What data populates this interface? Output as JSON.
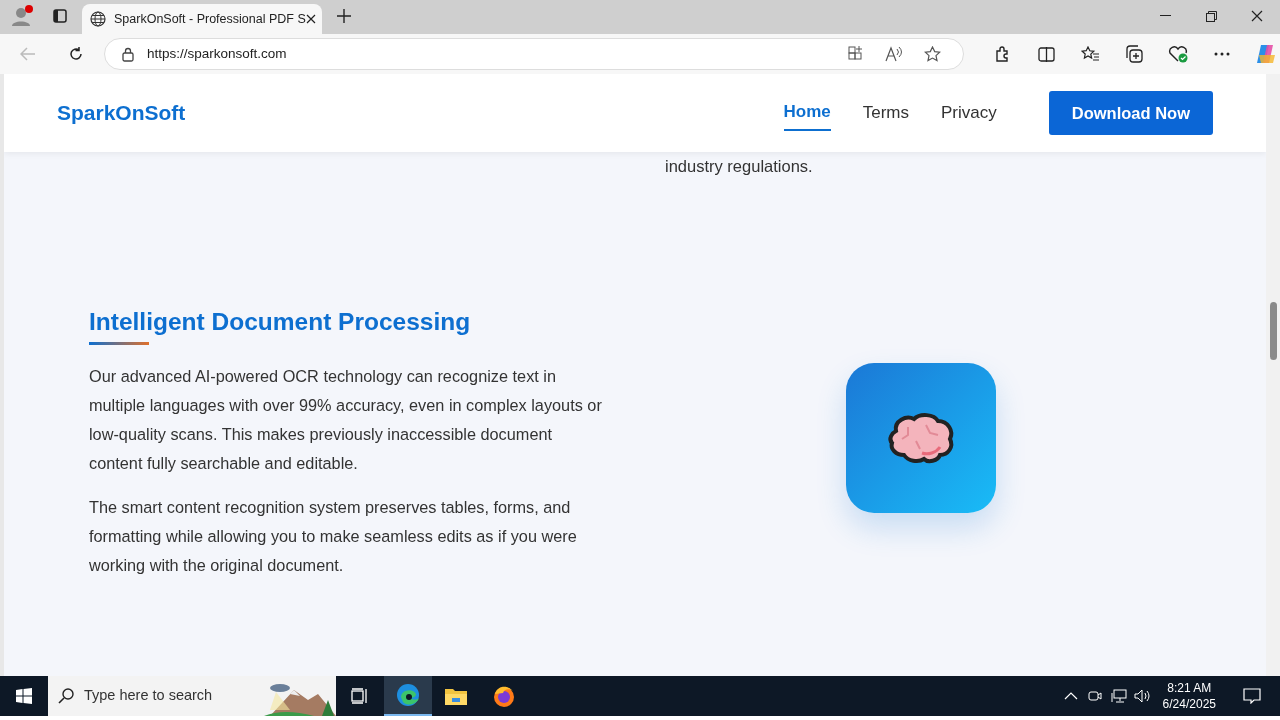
{
  "browser": {
    "tabs": [
      {
        "title": "SparkOnSoft - Professional PDF S",
        "selected": true
      }
    ],
    "address": "https://sparkonsoft.com"
  },
  "site": {
    "logo": "SparkOnSoft",
    "nav": [
      {
        "label": "Home",
        "selected": true
      },
      {
        "label": "Terms",
        "selected": false
      },
      {
        "label": "Privacy",
        "selected": false
      }
    ],
    "cta": "Download Now"
  },
  "content": {
    "previous_text": "industry regulations.",
    "heading": "Intelligent Document Processing",
    "paragraphs": [
      "Our advanced AI-powered OCR technology can recognize text in multiple languages with over 99% accuracy, even in complex layouts or low-quality scans. This makes previously inaccessible document content fully searchable and editable.",
      "The smart content recognition system preserves tables, forms, and formatting while allowing you to make seamless edits as if you were working with the original document."
    ]
  },
  "taskbar": {
    "search_placeholder": "Type here to search",
    "time": "8:21 AM",
    "date": "6/24/2025"
  }
}
